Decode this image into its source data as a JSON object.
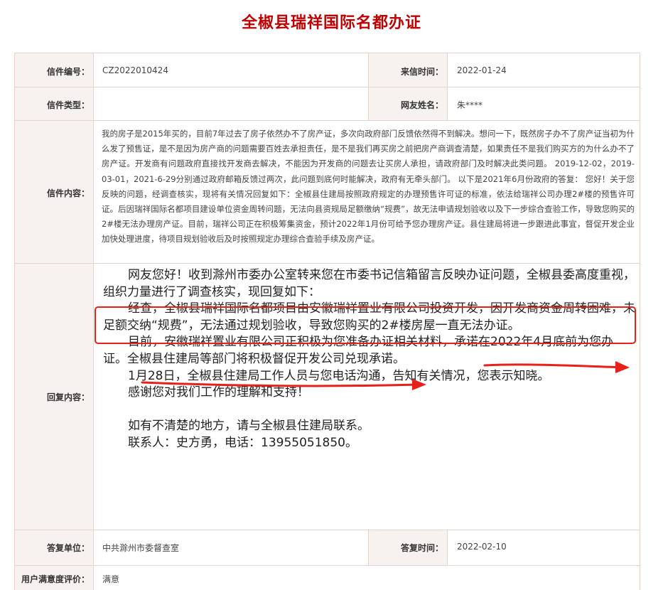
{
  "page": {
    "title": "全椒县瑞祥国际名都办证"
  },
  "labels": {
    "letter_no": "信件编号：",
    "letter_date": "来信时间：",
    "letter_type": "信件类型：",
    "netizen_name": "网友姓名：",
    "letter_content": "信件内容：",
    "reply_content": "回复内容：",
    "reply_unit": "答复单位：",
    "reply_date": "答复时间：",
    "satisfaction": "用户满意度评价："
  },
  "values": {
    "letter_no": "CZ2022010424",
    "letter_date": "2022-01-24",
    "letter_type": "",
    "netizen_name": "朱****",
    "letter_content": "我的房子是2015年买的，目前7年过去了房子依然办不了房产证，多次向政府部门反馈依然得不到解决。想问一下，既然房子办不了房产证当初为什么发了预售证，是不是因为房产商的问题需要百姓去承担责任，是不是我们再买房之前把房产商调查清楚，如果责任不是我们购买方的为什么办不了房产证。开发商有问题政府直接找开发商去解决，不能因为开发商的问题去让买房人承担，请政府部门及时解决此类问题。 2019-12-02，2019-03-01，2021-6-29分别通过政府邮箱反馈过两次，此问题到底何时能解决，政府有无牵头部门。 以下是2021年6月份政府的答复： 您好！关于您反映的问题，经调查核实，现将有关情况回复如下：全椒县住建局按照政府规定的办理预售许可证的标准，依法给瑞祥公司办理2#楼的预售许可证。后因瑞祥国际名都项目建设单位资金周转问题，无法向县资规局足额缴纳“规费”，故无法申请规划验收以及下一步综合查验工作，导致您购买的2#楼无法办理房产证。目前，瑞祥公司正在积极筹集资金，预计2022年1月份可给予您办理房产证。县住建局将进一步跟进此事宜，督促开发企业加快处理进度，待项目规划验收后及时按照规定办理综合查验手续及房产证。",
    "reply_unit": "中共滁州市委督查室",
    "reply_date": "2022-02-10",
    "satisfaction": "满意"
  },
  "reply": {
    "p1": "网友您好！收到滁州市委办公室转来您在市委书记信箱留言反映办证问题，全椒县委高度重视，组织力量进行了调查核实，现回复如下：",
    "p2": "经查，全椒县瑞祥国际名都项目由安徽瑞祥置业有限公司投资开发，因开发商资金周转困难，未足额交纳“规费”，无法通过规划验收，导致您购买的2#楼房屋一直无法办证。",
    "p3": "目前，安徽瑞祥置业有限公司正积极为您准备办证相关材料，承诺在2022年4月底前为您办证。全椒县住建局等部门将积极督促开发公司兑现承诺。",
    "p4": "1月28日，全椒县住建局工作人员与您电话沟通，告知有关情况，您表示知晓。",
    "p5": "感谢您对我们工作的理解和支持！",
    "p6": "如有不清楚的地方，请与全椒县住建局联系。",
    "p7": "联系人：史方勇，电话：13955051850。"
  },
  "colors": {
    "title": "#c00000",
    "label_bg": "#f7f1ef",
    "border": "#e6d3cd",
    "annotation_red": "#e8201a"
  }
}
